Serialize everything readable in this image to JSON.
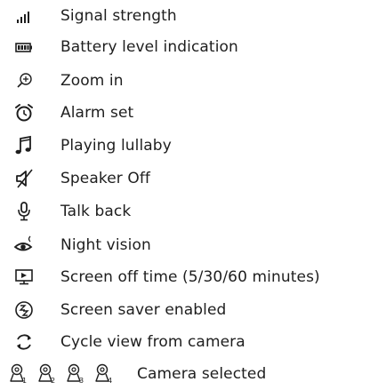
{
  "legend": {
    "items": [
      {
        "icon": "signal-strength-icon",
        "label": "Signal strength"
      },
      {
        "icon": "battery-icon",
        "label": "Battery level indication"
      },
      {
        "icon": "zoom-in-icon",
        "label": "Zoom in"
      },
      {
        "icon": "alarm-clock-icon",
        "label": "Alarm set"
      },
      {
        "icon": "music-note-icon",
        "label": "Playing lullaby"
      },
      {
        "icon": "speaker-off-icon",
        "label": "Speaker Off"
      },
      {
        "icon": "microphone-icon",
        "label": "Talk back"
      },
      {
        "icon": "night-vision-eye-icon",
        "label": "Night vision"
      },
      {
        "icon": "screen-timer-icon",
        "label": "Screen off time (5/30/60 minutes)"
      },
      {
        "icon": "screen-saver-zz-icon",
        "label": "Screen saver enabled"
      },
      {
        "icon": "cycle-arrows-icon",
        "label": "Cycle view from camera"
      }
    ],
    "camera_row": {
      "icon": "camera-icon",
      "numbers": [
        "1",
        "2",
        "3",
        "4"
      ],
      "label": "Camera selected"
    }
  },
  "colors": {
    "text": "#1e1e1e",
    "background": "#ffffff"
  }
}
